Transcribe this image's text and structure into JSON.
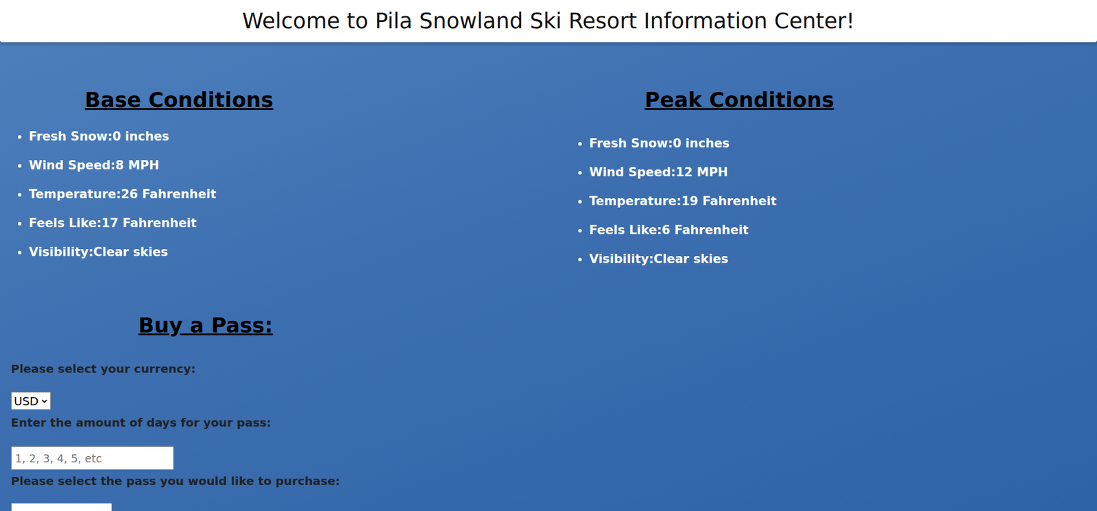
{
  "header": {
    "title": "Welcome to Pila Snowland Ski Resort Information Center!"
  },
  "conditions": [
    {
      "title": "Base Conditions",
      "items": [
        "Fresh Snow:0 inches",
        "Wind Speed:8 MPH",
        "Temperature:26 Fahrenheit",
        "Feels Like:17 Fahrenheit",
        "Visibility:Clear skies"
      ]
    },
    {
      "title": "Peak Conditions",
      "items": [
        "Fresh Snow:0 inches",
        "Wind Speed:12 MPH",
        "Temperature:19 Fahrenheit",
        "Feels Like:6 Fahrenheit",
        "Visibility:Clear skies"
      ]
    }
  ],
  "pass": {
    "title": "Buy a Pass:",
    "currency_label": "Please select your currency:",
    "currency_value": "USD",
    "days_label": "Enter the amount of days for your pass:",
    "days_placeholder": "1, 2, 3, 4, 5, etc",
    "pass_label": "Please select the pass you would like to purchase:"
  }
}
